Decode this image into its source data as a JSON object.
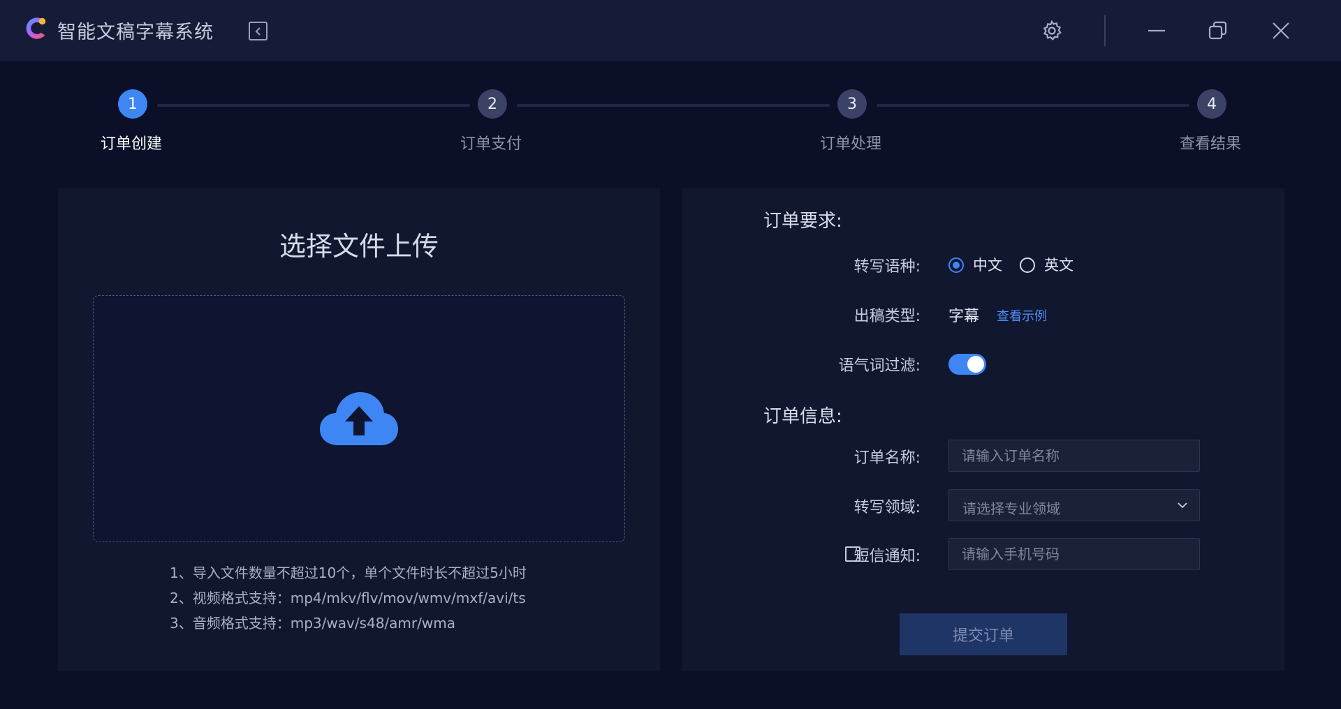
{
  "app": {
    "title": "智能文稿字幕系统"
  },
  "colors": {
    "accent": "#3f86f5",
    "background": "#0b1028",
    "panel": "#11172f",
    "titlebar": "#161c37"
  },
  "titlebar_icons": [
    "gear-icon",
    "minimize-icon",
    "restore-icon",
    "close-icon"
  ],
  "steps": [
    {
      "number": "1",
      "label": "订单创建",
      "active": true
    },
    {
      "number": "2",
      "label": "订单支付",
      "active": false
    },
    {
      "number": "3",
      "label": "订单处理",
      "active": false
    },
    {
      "number": "4",
      "label": "查看结果",
      "active": false
    }
  ],
  "upload": {
    "title": "选择文件上传",
    "hints": [
      "1、导入文件数量不超过10个，单个文件时长不超过5小时",
      "2、视频格式支持：mp4/mkv/flv/mov/wmv/mxf/avi/ts",
      "3、音频格式支持：mp3/wav/s48/amr/wma"
    ]
  },
  "requirements": {
    "title": "订单要求:",
    "language_label": "转写语种:",
    "language_options": [
      "中文",
      "英文"
    ],
    "language_selected": "中文",
    "output_label": "出稿类型:",
    "output_value": "字幕",
    "output_example_link": "查看示例",
    "filter_label": "语气词过滤:",
    "filter_on": true
  },
  "info": {
    "title": "订单信息:",
    "name_label": "订单名称:",
    "name_placeholder": "请输入订单名称",
    "domain_label": "转写领域:",
    "domain_placeholder": "请选择专业领域",
    "sms_label": "短信通知:",
    "sms_checked": false,
    "sms_placeholder": "请输入手机号码"
  },
  "submit_label": "提交订单"
}
